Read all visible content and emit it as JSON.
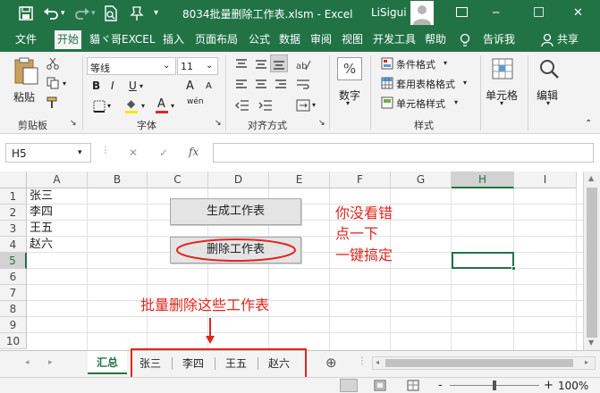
{
  "title_bar": {
    "save_icon": "save-icon",
    "undo_icon": "undo-icon",
    "redo_icon": "redo-icon",
    "preview_icon": "print-preview-icon",
    "pin_icon": "pin-icon",
    "qat_icon": "customize-qat-icon",
    "title": "8034批量删除工作表.xlsm  -  Excel",
    "user": "LiSigui",
    "minimize": "─",
    "maximize": "□",
    "close": "✕"
  },
  "ribbon_tabs": [
    "文件",
    "开始",
    "貓ヾ哥EXCEL",
    "插入",
    "页面布局",
    "公式",
    "数据",
    "审阅",
    "视图",
    "开发工具",
    "帮助",
    "告诉我",
    "共享"
  ],
  "active_tab": "开始",
  "ribbon": {
    "clipboard": {
      "paste": "粘贴",
      "group": "剪贴板"
    },
    "font": {
      "name": "等线",
      "size": "11",
      "bold": "B",
      "italic": "I",
      "underline": "U",
      "grow": "A",
      "shrink": "A",
      "fill": "◆",
      "color": "A",
      "wen": "wén",
      "group": "字体"
    },
    "alignment": {
      "group": "对齐方式"
    },
    "number": {
      "label": "数字",
      "percent": "%"
    },
    "styles": {
      "conditional": "条件格式",
      "table": "套用表格格式",
      "cell_style": "单元格样式",
      "group": "样式"
    },
    "cells": {
      "label": "单元格"
    },
    "editing": {
      "label": "编辑"
    }
  },
  "formula_bar": {
    "name_box": "H5",
    "cancel": "✕",
    "enter": "✓",
    "fx": "fx",
    "value": ""
  },
  "columns": [
    "A",
    "B",
    "C",
    "D",
    "E",
    "F",
    "G",
    "H",
    "I"
  ],
  "rows": [
    "1",
    "2",
    "3",
    "4",
    "5",
    "6",
    "7",
    "8",
    "9",
    "10"
  ],
  "selected_cell": "H5",
  "cells": {
    "A1": "张三",
    "A2": "李四",
    "A3": "王五",
    "A4": "赵六"
  },
  "buttons": {
    "generate": "生成工作表",
    "delete": "删除工作表"
  },
  "annotations": {
    "note": [
      "你没看错",
      "点一下",
      "一键搞定"
    ],
    "batch": "批量删除这些工作表"
  },
  "sheet_tabs": [
    "汇总",
    "张三",
    "李四",
    "王五",
    "赵六"
  ],
  "active_sheet": "汇总",
  "add_sheet": "⊕",
  "status": {
    "zoom": "100%",
    "minus": "-",
    "plus": "+"
  },
  "colors": {
    "excel_green": "#217346",
    "annotation_red": "#e0261e"
  }
}
